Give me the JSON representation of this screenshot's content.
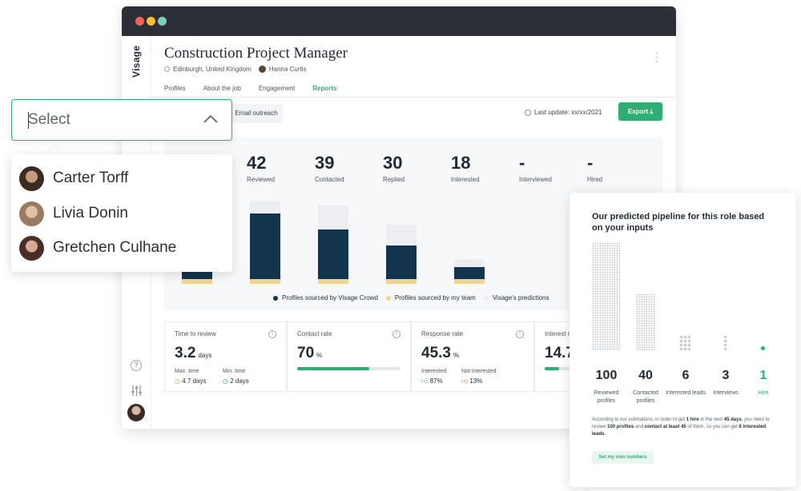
{
  "window": {
    "brand": "Visage",
    "job_title": "Construction Project Manager",
    "location": "Edinburgh, United Kingdom",
    "owner": "Hanna Curtis",
    "tabs": [
      {
        "label": "Profiles",
        "active": false
      },
      {
        "label": "About the job",
        "active": false
      },
      {
        "label": "Engagement",
        "active": false
      },
      {
        "label": "Reports",
        "active": true
      }
    ],
    "subbar_button": "Email outreach",
    "last_update": "Last update: xx/xx/2021",
    "export_label": "Export",
    "accent_color": "#2fae74"
  },
  "stats": [
    {
      "value": "42",
      "label": "Reviewed"
    },
    {
      "value": "39",
      "label": "Contacted"
    },
    {
      "value": "30",
      "label": "Replied"
    },
    {
      "value": "18",
      "label": "Interested"
    },
    {
      "value": "-",
      "label": "Interviewed"
    },
    {
      "value": "-",
      "label": "Hired"
    }
  ],
  "chart_data": {
    "type": "bar",
    "stacked": true,
    "series": [
      {
        "name": "Profiles sourced by Visage Crowd",
        "color": "#12344d",
        "values": [
          14,
          82,
          62,
          42,
          15
        ]
      },
      {
        "name": "Profiles sourced by my team",
        "color": "#f0d68c",
        "values": [
          6,
          6,
          6,
          6,
          6
        ]
      },
      {
        "name": "Visage's predictions",
        "color": "#eceef2",
        "values": [
          0,
          16,
          30,
          26,
          10
        ]
      }
    ],
    "legend_position": "bottom"
  },
  "metrics": {
    "time_to_review": {
      "title": "Time to review",
      "value": "3.2",
      "unit": "days",
      "max_label": "Max. time",
      "max_value": "4.7 days",
      "min_label": "Min. time",
      "min_value": "2 days"
    },
    "contact_rate": {
      "title": "Contact rate",
      "value": "70",
      "unit": "%",
      "progress": 0.7
    },
    "response_rate": {
      "title": "Response rate",
      "value": "45.3",
      "unit": "%",
      "interested_label": "Interested",
      "interested_value": "87%",
      "not_interested_label": "Not interested",
      "not_interested_value": "13%"
    },
    "interest_rate": {
      "title": "Interest r",
      "value": "14.7",
      "progress": 0.15
    }
  },
  "select": {
    "placeholder": "Select",
    "options": [
      {
        "name": "Carter Torff"
      },
      {
        "name": "Livia Donin"
      },
      {
        "name": "Gretchen Culhane"
      }
    ]
  },
  "prediction": {
    "title": "Our predicted pipeline for this role based on your inputs",
    "steps": [
      {
        "value": "100",
        "label": "Reviewed profiles"
      },
      {
        "value": "40",
        "label": "Contacted profiles"
      },
      {
        "value": "6",
        "label": "Interested leads"
      },
      {
        "value": "3",
        "label": "Interviews"
      },
      {
        "value": "1",
        "label": "Hire"
      }
    ],
    "note_parts": {
      "p1": "According to our estimations, in order to get ",
      "b1": "1 hire",
      "p2": " in the next ",
      "b2": "45 days",
      "p3": ", you need to review ",
      "b3": "100 profiles",
      "p4": " and ",
      "b4": "contact at least 45",
      "p5": " of them, so you can get ",
      "b5": "6 interested leads",
      "p6": "."
    },
    "button_label": "Set my own numbers"
  }
}
